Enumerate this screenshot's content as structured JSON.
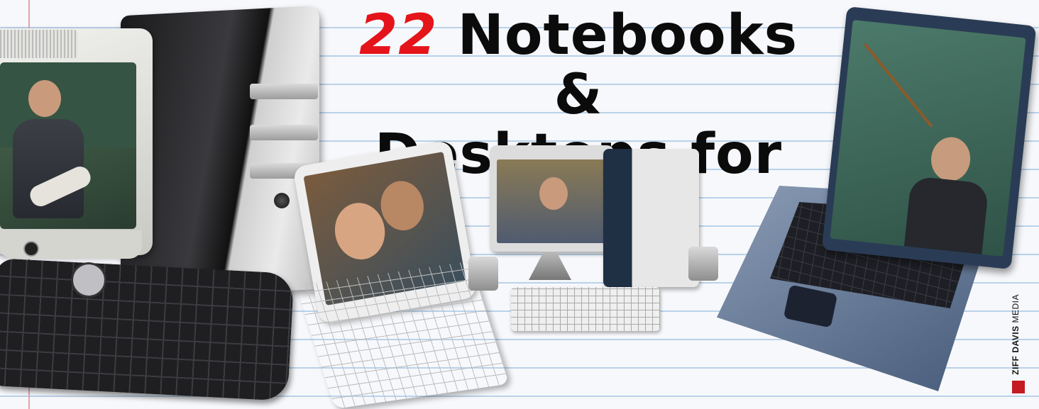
{
  "headline": {
    "number": "22",
    "line1_rest": "Notebooks &",
    "line2": "Desktops for Fall"
  },
  "publisher": {
    "brand_bold": "ZIFF DAVIS",
    "brand_regular": "MEDIA"
  },
  "icons": [
    "ziff-davis-logo-icon"
  ],
  "colors": {
    "headline_text": "#0b0b0b",
    "headline_number": "#e4141a",
    "paper": "#f7f8fb",
    "rule_line": "#b9d2ea",
    "margin_line": "#e7a3a8"
  }
}
